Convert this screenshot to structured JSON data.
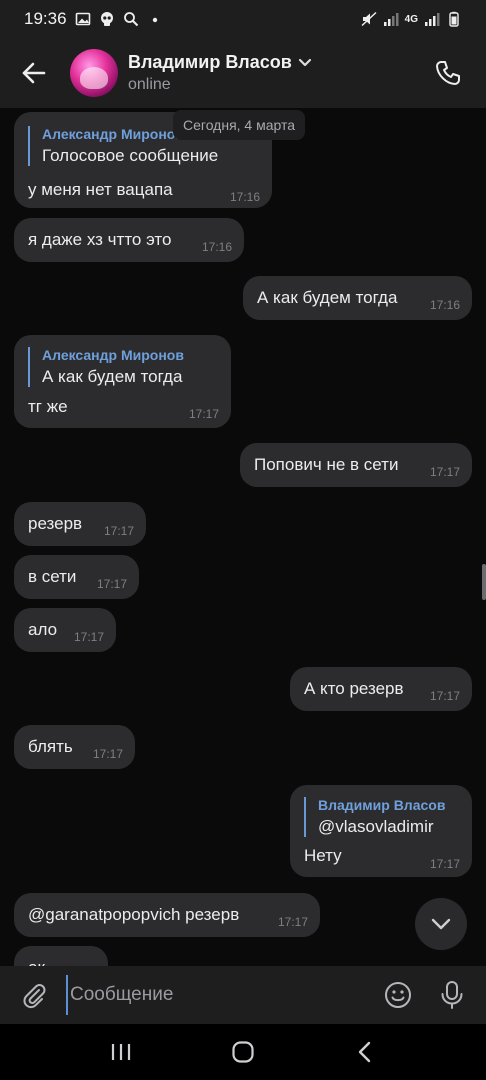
{
  "status_bar": {
    "time": "19:36",
    "network": "4G"
  },
  "header": {
    "name": "Владимир Власов",
    "status": "online"
  },
  "date_pill": "Сегодня, 4 марта",
  "messages": [
    {
      "reply_author": "Александр Миронов",
      "reply_text": "Голосовое сообщение",
      "text": "у меня нет вацапа",
      "time": "17:16"
    },
    {
      "text": "я даже хз чтто это",
      "time": "17:16"
    },
    {
      "text": "А как будем тогда",
      "time": "17:16"
    },
    {
      "reply_author": "Александр Миронов",
      "reply_text": "А как будем тогда",
      "text": "тг же",
      "time": "17:17"
    },
    {
      "text": "Попович не в сети",
      "time": "17:17"
    },
    {
      "text": "резерв",
      "time": "17:17"
    },
    {
      "text": "в сети",
      "time": "17:17"
    },
    {
      "text": "ало",
      "time": "17:17"
    },
    {
      "text": "А кто резерв",
      "time": "17:17"
    },
    {
      "text": "блять",
      "time": "17:17"
    },
    {
      "reply_author": "Владимир Власов",
      "reply_text": "@vlasovladimir",
      "text": "Нету",
      "time": "17:17"
    },
    {
      "text": "@garanatpopopvich резерв",
      "time": "17:17"
    },
    {
      "text": "ок",
      "time": ""
    }
  ],
  "composer": {
    "placeholder": "Сообщение"
  }
}
